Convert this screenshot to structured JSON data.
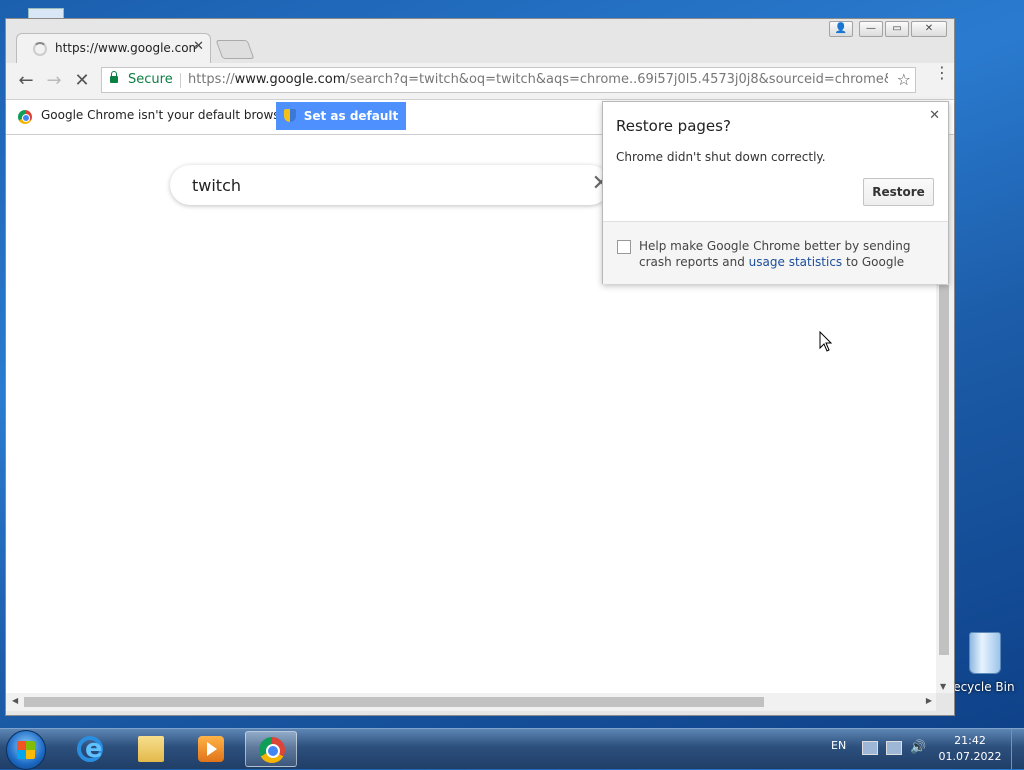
{
  "desktop": {
    "recycle_bin_label": "Recycle Bin"
  },
  "browser": {
    "tab": {
      "title": "https://www.google.com",
      "close": "✕"
    },
    "window_controls": {
      "user": "👤",
      "minimize": "—",
      "maximize": "▭",
      "close": "✕"
    },
    "toolbar": {
      "back": "←",
      "forward": "→",
      "stop": "✕",
      "secure_label": "Secure",
      "url_scheme": "https://",
      "url_host": "www.google.com",
      "url_rest": "/search?q=twitch&oq=twitch&aqs=chrome..69i57j0l5.4573j0j8&sourceid=chrome&ie...",
      "star": "☆",
      "menu": "⋮"
    },
    "infobar": {
      "message": "Google Chrome isn't your default browser.",
      "button_label": "Set as default"
    },
    "page": {
      "search_value": "twitch",
      "search_clear": "✕"
    },
    "restore_popup": {
      "title": "Restore pages?",
      "message": "Chrome didn't shut down correctly.",
      "restore_button": "Restore",
      "close": "✕",
      "checkbox_text_before": "Help make Google Chrome better by sending crash reports and ",
      "checkbox_link": "usage statistics",
      "checkbox_text_after": " to Google"
    },
    "scroll": {
      "left": "◀",
      "right": "▶",
      "down": "▼"
    }
  },
  "taskbar": {
    "language": "EN",
    "time": "21:42",
    "date": "01.07.2022",
    "items": [
      "internet-explorer",
      "file-explorer",
      "media-player",
      "google-chrome"
    ]
  },
  "colors": {
    "accent_button": "#4d90fe",
    "secure_green": "#0b8043",
    "link_blue": "#1a4d9c"
  }
}
